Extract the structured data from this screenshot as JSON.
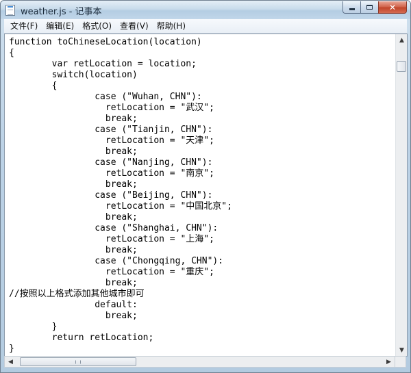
{
  "window": {
    "title": "weather.js - 记事本"
  },
  "menu": [
    {
      "label": "文件(F)"
    },
    {
      "label": "编辑(E)"
    },
    {
      "label": "格式(O)"
    },
    {
      "label": "查看(V)"
    },
    {
      "label": "帮助(H)"
    }
  ],
  "editor": {
    "lines": [
      "function toChineseLocation(location)",
      "{",
      "        var retLocation = location;",
      "        switch(location)",
      "        {",
      "                case (\"Wuhan, CHN\"):",
      "                  retLocation = \"武汉\";",
      "                  break;",
      "                case (\"Tianjin, CHN\"):",
      "                  retLocation = \"天津\";",
      "                  break;",
      "                case (\"Nanjing, CHN\"):",
      "                  retLocation = \"南京\";",
      "                  break;",
      "                case (\"Beijing, CHN\"):",
      "                  retLocation = \"中国北京\";",
      "                  break;",
      "                case (\"Shanghai, CHN\"):",
      "                  retLocation = \"上海\";",
      "                  break;",
      "                case (\"Chongqing, CHN\"):",
      "                  retLocation = \"重庆\";",
      "                  break;",
      "//按照以上格式添加其他城市即可",
      "                default:",
      "                  break;",
      "        }",
      "        return retLocation;",
      "}"
    ]
  },
  "icons": {
    "minimize": "minimize-icon",
    "maximize": "maximize-icon",
    "close": "close-icon",
    "scroll_up": "arrow-up-icon",
    "scroll_down": "arrow-down-icon",
    "scroll_left": "arrow-left-icon",
    "scroll_right": "arrow-right-icon"
  },
  "glyphs": {
    "close": "✕",
    "up": "▲",
    "down": "▼",
    "left": "◀",
    "right": "▶"
  }
}
